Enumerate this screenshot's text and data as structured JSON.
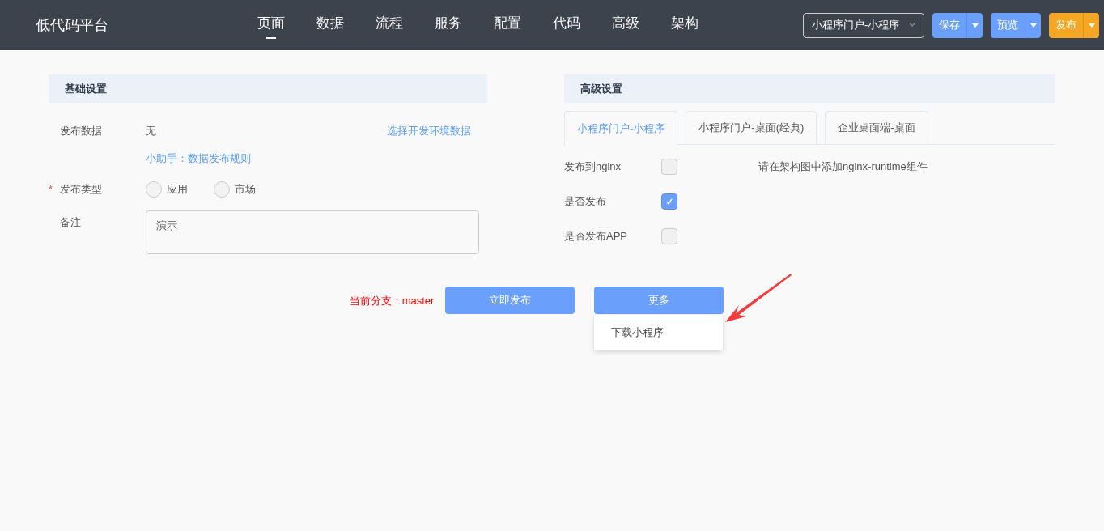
{
  "header": {
    "brand": "低代码平台",
    "nav": [
      {
        "label": "页面",
        "selected": true
      },
      {
        "label": "数据",
        "selected": false
      },
      {
        "label": "流程",
        "selected": false
      },
      {
        "label": "服务",
        "selected": false
      },
      {
        "label": "配置",
        "selected": false
      },
      {
        "label": "代码",
        "selected": false
      },
      {
        "label": "高级",
        "selected": false
      },
      {
        "label": "架构",
        "selected": false
      }
    ],
    "portal_select": "小程序门户-小程序",
    "actions": [
      {
        "label": "保存",
        "kind": "primary"
      },
      {
        "label": "预览",
        "kind": "primary"
      },
      {
        "label": "发布",
        "kind": "warning"
      }
    ]
  },
  "basic": {
    "title": "基础设置",
    "publish_data": {
      "label": "发布数据",
      "value": "无",
      "link": "选择开发环境数据",
      "help": "小助手：数据发布规则"
    },
    "publish_type": {
      "label": "发布类型",
      "required_mark": "*",
      "options": [
        {
          "label": "应用",
          "selected": false
        },
        {
          "label": "市场",
          "selected": false
        }
      ]
    },
    "remark": {
      "label": "备注",
      "value": "演示"
    }
  },
  "advanced": {
    "title": "高级设置",
    "tabs": [
      {
        "label": "小程序门户-小程序",
        "selected": true
      },
      {
        "label": "小程序门户-桌面(经典)",
        "selected": false
      },
      {
        "label": "企业桌面端-桌面",
        "selected": false
      }
    ],
    "options": [
      {
        "label": "发布到nginx",
        "checked": false,
        "note": "请在架构图中添加nginx-runtime组件"
      },
      {
        "label": "是否发布",
        "checked": true
      },
      {
        "label": "是否发布APP",
        "checked": false
      }
    ]
  },
  "footer": {
    "branch": "当前分支：master",
    "publish_button": "立即发布",
    "more_button": "更多",
    "menu": [
      "下载小程序"
    ]
  }
}
